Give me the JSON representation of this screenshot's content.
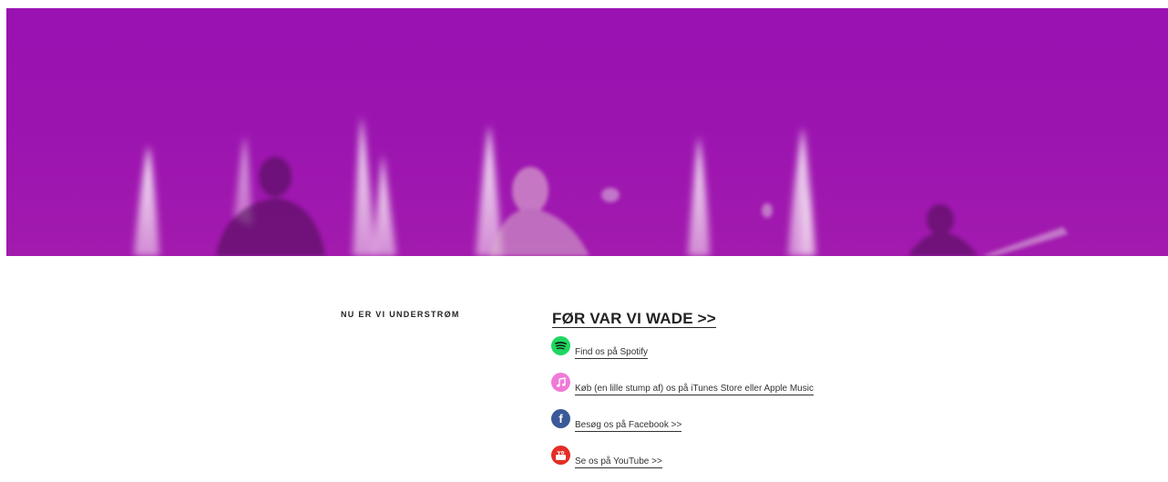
{
  "hero": {
    "description_colors": {
      "tint": "#9b14b0"
    }
  },
  "widget": {
    "title": "NU ER VI UNDERSTRØM"
  },
  "content": {
    "heading": "FØR VAR VI WADE >>",
    "links": [
      {
        "icon": "spotify-icon",
        "label": "Find os på Spotify",
        "color": "#1ed760"
      },
      {
        "icon": "itunes-icon",
        "label": "Køb (en lille stump af) os på iTunes Store eller Apple Music",
        "color": "#f07ad8"
      },
      {
        "icon": "facebook-icon",
        "label": "Besøg os på Facebook >>",
        "color": "#3b5998"
      },
      {
        "icon": "youtube-icon",
        "label": "Se os på YouTube >>",
        "color": "#e52d27"
      }
    ]
  }
}
